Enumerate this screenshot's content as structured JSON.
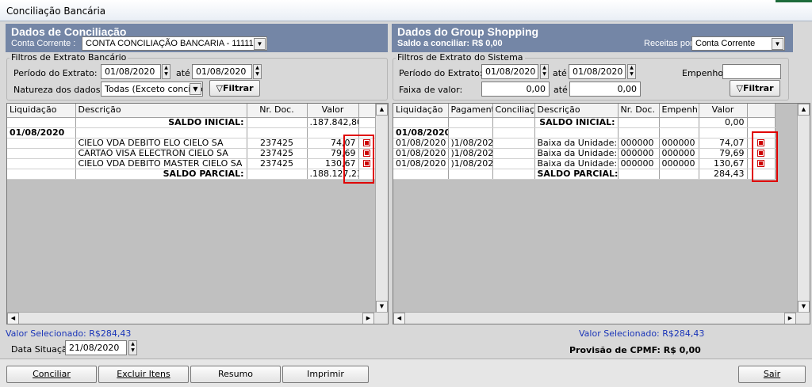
{
  "window": {
    "title": "Conciliação Bancária"
  },
  "left": {
    "header_title": "Dados de Conciliação",
    "conta_label": "Conta Corrente :",
    "conta_value": "CONTA CONCILIAÇÃO BANCARIA - 11111",
    "filters_legend": "Filtros de Extrato Bancário",
    "periodo_label": "Período do Extrato:",
    "date_from": "01/08/2020",
    "ate_label": "até",
    "date_to": "01/08/2020",
    "natureza_label": "Natureza dos dados:",
    "natureza_value": "Todas (Exceto conciliad",
    "filtrar_label": "Filtrar",
    "columns": [
      "Liquidação",
      "Descrição",
      "Nr. Doc.",
      "Valor"
    ],
    "rows": [
      {
        "liq": "",
        "desc": "SALDO INICIAL:",
        "doc": "",
        "valor": ".187.842,80",
        "bold": true,
        "check": false
      },
      {
        "liq": "01/08/2020",
        "desc": "",
        "doc": "",
        "valor": "",
        "bold": true,
        "check": false
      },
      {
        "liq": "",
        "desc": "CIELO VDA DEBITO ELO CIELO SA",
        "doc": "237425",
        "valor": "74,07",
        "bold": false,
        "check": true
      },
      {
        "liq": "",
        "desc": "CARTAO VISA ELECTRON CIELO SA",
        "doc": "237425",
        "valor": "79,69",
        "bold": false,
        "check": true
      },
      {
        "liq": "",
        "desc": "CIELO VDA DEBITO MASTER CIELO SA",
        "doc": "237425",
        "valor": "130,67",
        "bold": false,
        "check": true
      },
      {
        "liq": "",
        "desc": "SALDO PARCIAL:",
        "doc": "",
        "valor": ".188.127,23",
        "bold": true,
        "check": false
      }
    ],
    "valor_selecionado": "Valor Selecionado: R$284,43",
    "data_situacao_label": "Data Situação:",
    "data_situacao_value": "21/08/2020"
  },
  "right": {
    "header_title": "Dados do Group Shopping",
    "saldo_conciliar": "Saldo a conciliar: R$ 0,00",
    "receitas_label": "Receitas por",
    "receitas_value": "Conta Corrente",
    "filters_legend": "Filtros de Extrato do Sistema",
    "periodo_label": "Período do Extrato:",
    "date_from": "01/08/2020",
    "ate_label": "até",
    "date_to": "01/08/2020",
    "empenho_label": "Empenho:",
    "empenho_value": "",
    "faixa_label": "Faixa de valor:",
    "faixa_from": "0,00",
    "faixa_ate": "até",
    "faixa_to": "0,00",
    "filtrar_label": "Filtrar",
    "columns": [
      "Liquidação",
      "Pagament",
      "Conciliaçã",
      "Descrição",
      "Nr. Doc.",
      "Empenh",
      "Valor"
    ],
    "rows": [
      {
        "liq": "",
        "pag": "",
        "conc": "",
        "desc": "SALDO INICIAL:",
        "doc": "",
        "emp": "",
        "valor": "0,00",
        "bold": true,
        "check": false
      },
      {
        "liq": "01/08/2020",
        "pag": "",
        "conc": "",
        "desc": "",
        "doc": "",
        "emp": "",
        "valor": "",
        "bold": true,
        "check": false
      },
      {
        "liq": "01/08/2020",
        "pag": ")1/08/2020",
        "conc": "",
        "desc": "Baixa da Unidade: OUT",
        "doc": "000000",
        "emp": "000000",
        "valor": "74,07",
        "bold": false,
        "check": true
      },
      {
        "liq": "01/08/2020",
        "pag": ")1/08/2020",
        "conc": "",
        "desc": "Baixa da Unidade: OUT",
        "doc": "000000",
        "emp": "000000",
        "valor": "79,69",
        "bold": false,
        "check": true
      },
      {
        "liq": "01/08/2020",
        "pag": ")1/08/2020",
        "conc": "",
        "desc": "Baixa da Unidade: OUT",
        "doc": "000000",
        "emp": "000000",
        "valor": "130,67",
        "bold": false,
        "check": true
      },
      {
        "liq": "",
        "pag": "",
        "conc": "",
        "desc": "SALDO PARCIAL:",
        "doc": "",
        "emp": "",
        "valor": "284,43",
        "bold": true,
        "check": false
      }
    ],
    "valor_selecionado": "Valor Selecionado: R$284,43",
    "provisao": "Provisão de CPMF:  R$ 0,00"
  },
  "footer": {
    "conciliar": "Conciliar",
    "excluir": "Excluir Itens",
    "resumo": "Resumo",
    "imprimir": "Imprimir",
    "sair": "Sair"
  },
  "colors": {
    "header_bg": "#7486a6",
    "highlight_red": "#e00000",
    "link_blue": "#1a35b8"
  }
}
